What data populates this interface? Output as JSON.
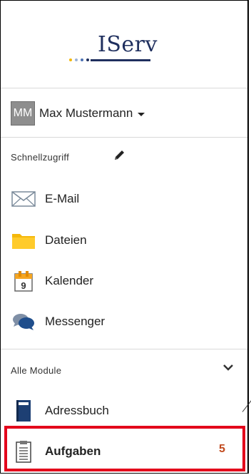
{
  "brand": {
    "name": "IServ",
    "color": "#1f2f5e"
  },
  "user": {
    "initials": "MM",
    "name": "Max Mustermann"
  },
  "quick_access": {
    "label": "Schnellzugriff",
    "items": [
      {
        "label": "E-Mail",
        "icon": "mail-icon"
      },
      {
        "label": "Dateien",
        "icon": "folder-icon"
      },
      {
        "label": "Kalender",
        "icon": "calendar-icon",
        "day": "9"
      },
      {
        "label": "Messenger",
        "icon": "chat-icon"
      }
    ]
  },
  "all_modules": {
    "label": "Alle Module",
    "items": [
      {
        "label": "Adressbuch",
        "icon": "addressbook-icon"
      },
      {
        "label": "Aufgaben",
        "icon": "clipboard-icon",
        "count": "5"
      }
    ]
  },
  "colors": {
    "highlight": "#e3001b",
    "badge": "#c1491d"
  }
}
